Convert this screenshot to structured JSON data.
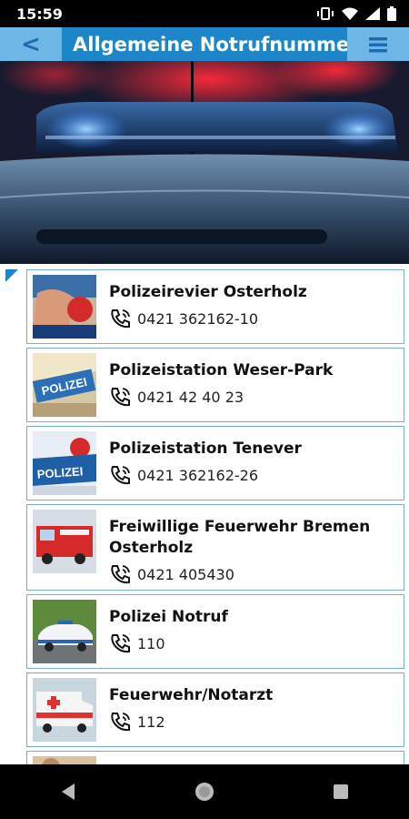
{
  "status": {
    "time": "15:59"
  },
  "app_bar": {
    "back_label": "<",
    "title": "Allgemeine Notrufnummern"
  },
  "contacts": [
    {
      "name": "Polizeirevier Osterholz",
      "phone": "0421 362162-10",
      "thumb": "police-officer-photo"
    },
    {
      "name": "Polizeistation Weser-Park",
      "phone": "0421 42 40 23",
      "thumb": "polizei-sign-photo"
    },
    {
      "name": "Polizeistation Tenever",
      "phone": "0421 362162-26",
      "thumb": "police-car-roof-photo"
    },
    {
      "name": "Freiwillige Feuerwehr Bremen Osterholz",
      "phone": "0421 405430",
      "thumb": "fire-truck-photo"
    },
    {
      "name": "Polizei Notruf",
      "phone": "110",
      "thumb": "police-car-photo"
    },
    {
      "name": "Feuerwehr/Notarzt",
      "phone": "112",
      "thumb": "ambulance-photo"
    }
  ],
  "colors": {
    "app_bar": "#6cb7e6",
    "title_bg": "#1d86c8",
    "card_border": "#7aaed6"
  }
}
